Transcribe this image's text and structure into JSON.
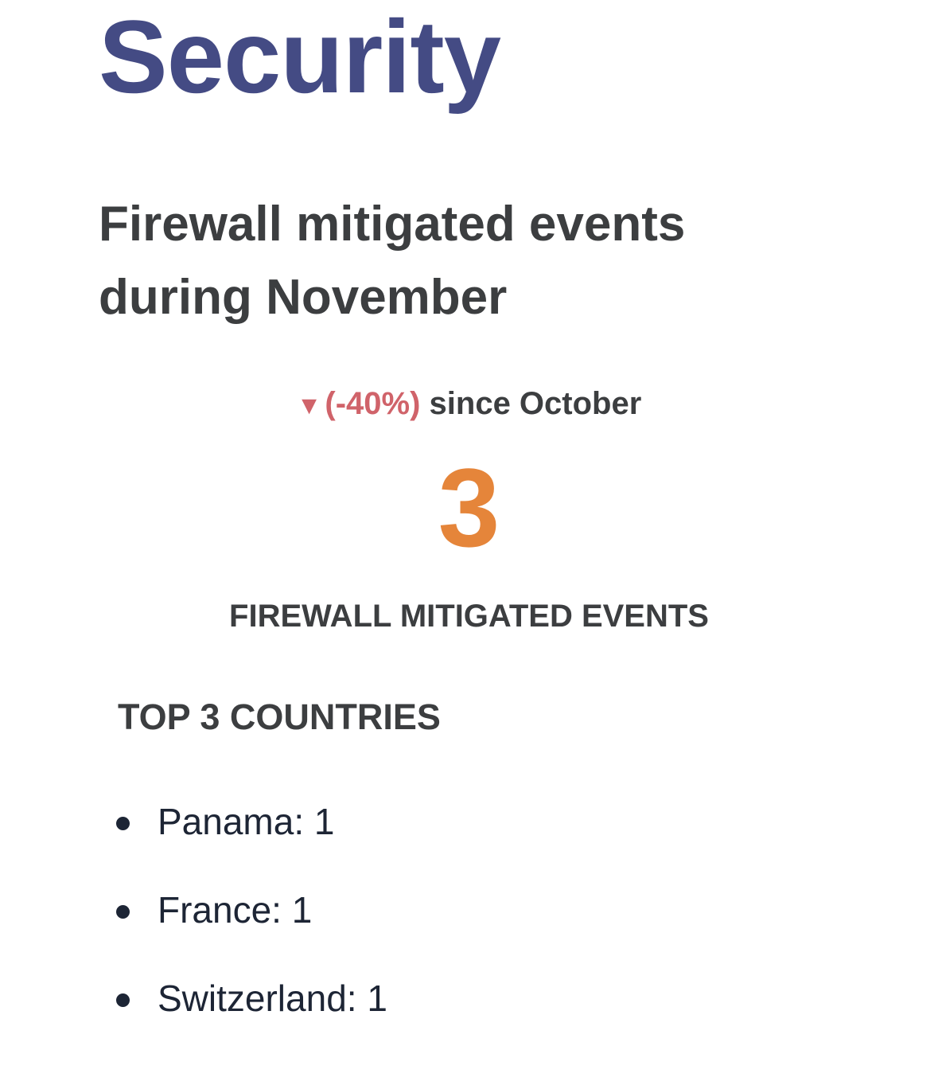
{
  "page": {
    "title": "Security"
  },
  "section": {
    "title": "Firewall mitigated events during November"
  },
  "change": {
    "arrow": "▼",
    "percent": "(-40%)",
    "suffix": "since October",
    "direction": "down",
    "color": "#d0636a"
  },
  "metric": {
    "value": "3",
    "label": "FIREWALL MITIGATED EVENTS",
    "color": "#e5853a"
  },
  "countries": {
    "heading": "TOP 3 COUNTRIES",
    "items": [
      {
        "text": "Panama: 1"
      },
      {
        "text": "France: 1"
      },
      {
        "text": "Switzerland: 1"
      }
    ]
  },
  "colors": {
    "title": "#444b84",
    "text": "#3c3e40",
    "list_text": "#1d2535"
  }
}
